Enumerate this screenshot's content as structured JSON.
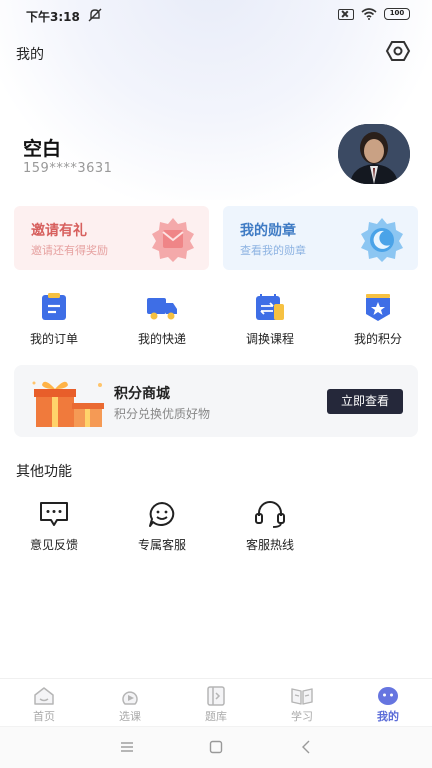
{
  "status_bar": {
    "time": "下午3:18",
    "battery": "100"
  },
  "header": {
    "title": "我的"
  },
  "profile": {
    "name": "空白",
    "phone": "159****3631"
  },
  "cards": {
    "invite": {
      "title": "邀请有礼",
      "subtitle": "邀请还有得奖励"
    },
    "medal": {
      "title": "我的勋章",
      "subtitle": "查看我的勋章"
    }
  },
  "quick_menu": [
    {
      "label": "我的订单",
      "icon": "order-icon"
    },
    {
      "label": "我的快递",
      "icon": "truck-icon"
    },
    {
      "label": "调换课程",
      "icon": "swap-course-icon"
    },
    {
      "label": "我的积分",
      "icon": "points-star-icon"
    }
  ],
  "mall": {
    "title": "积分商城",
    "subtitle": "积分兑换优质好物",
    "button": "立即查看"
  },
  "other": {
    "title": "其他功能",
    "items": [
      {
        "label": "意见反馈",
        "icon": "feedback-icon"
      },
      {
        "label": "专属客服",
        "icon": "customer-service-icon"
      },
      {
        "label": "客服热线",
        "icon": "headset-icon"
      }
    ]
  },
  "tabbar": [
    {
      "label": "首页",
      "icon": "home-icon"
    },
    {
      "label": "选课",
      "icon": "course-select-icon"
    },
    {
      "label": "题库",
      "icon": "question-bank-icon"
    },
    {
      "label": "学习",
      "icon": "study-book-icon"
    },
    {
      "label": "我的",
      "icon": "profile-face-icon",
      "active": true
    }
  ],
  "colors": {
    "accent": "#5b6cd8",
    "invite_bg": "#fdf0f0",
    "medal_bg": "#eef5fd",
    "button_dark": "#25283a",
    "icon_blue": "#3e6ee6",
    "icon_yellow": "#f6c142"
  }
}
